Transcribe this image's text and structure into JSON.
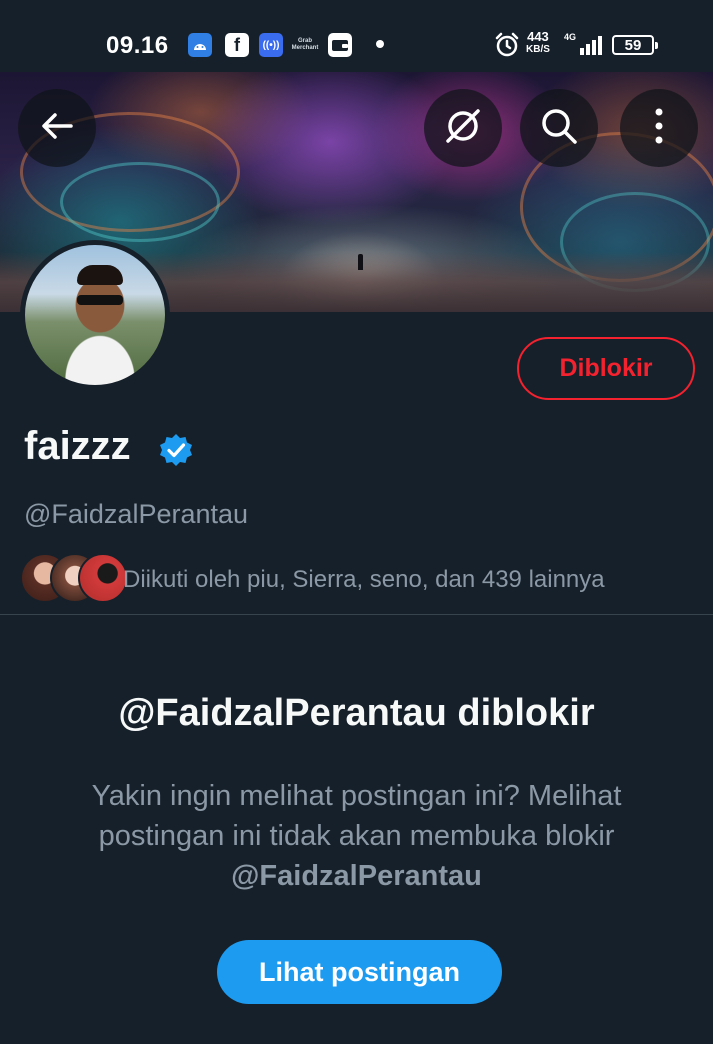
{
  "status_bar": {
    "time": "09.16",
    "grab_label": "Grab Merchant",
    "net_speed_value": "443",
    "net_speed_unit": "KB/S",
    "network_type": "4G",
    "battery": "59"
  },
  "header": {
    "back_icon": "arrow-left-icon",
    "grok_icon": "grok-icon",
    "search_icon": "search-icon",
    "more_icon": "more-vertical-icon"
  },
  "profile": {
    "display_name": "faizzz",
    "handle": "@FaidzalPerantau",
    "verified": true,
    "blocked_button_label": "Diblokir",
    "followed_by_text": "Diikuti oleh piu, Sierra, seno, dan 439 lainnya"
  },
  "blocked_notice": {
    "title": "@FaidzalPerantau diblokir",
    "description": "Yakin ingin melihat postingan ini? Melihat postingan ini tidak akan membuka blokir",
    "handle": "@FaidzalPerantau",
    "button_label": "Lihat postingan"
  },
  "colors": {
    "background": "#16202a",
    "accent": "#1d9bf0",
    "blocked_red": "#f4212e",
    "muted_text": "#8b98a5"
  }
}
